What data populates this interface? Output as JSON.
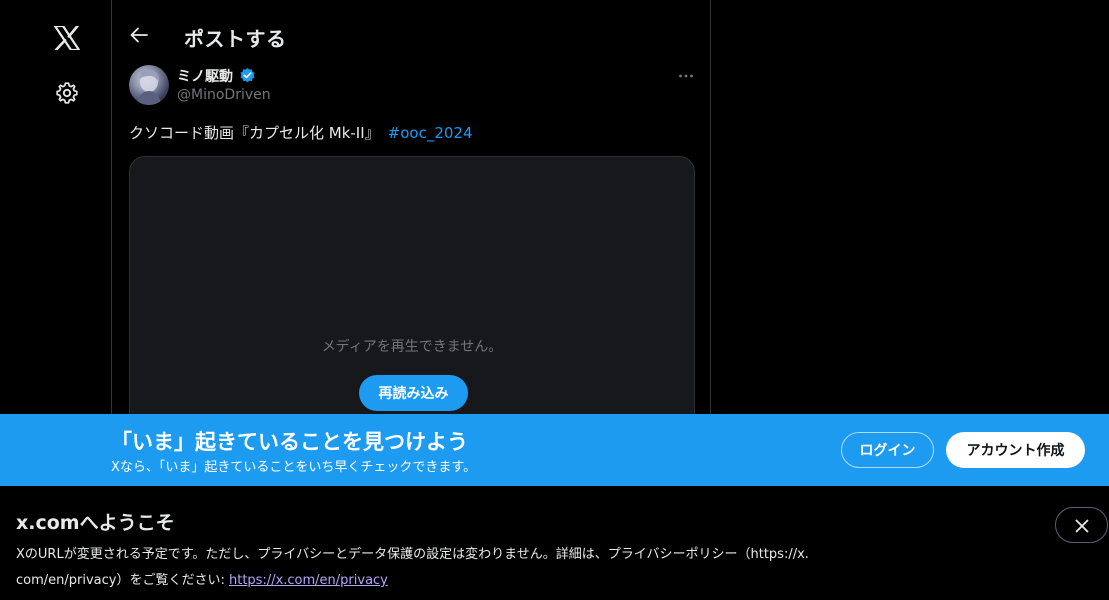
{
  "nav": {
    "logo_icon": "x-logo-icon",
    "settings_icon": "gear-icon"
  },
  "header": {
    "title": "ポストする",
    "back_icon": "arrow-left-icon"
  },
  "post": {
    "author_name": "ミノ駆動",
    "author_handle": "@MinoDriven",
    "verified_icon": "verified-badge-icon",
    "more_icon": "more-horizontal-icon",
    "text": "クソコード動画『カプセル化 Mk-II』",
    "hashtag": "#ooc_2024",
    "media_message": "メディアを再生できません。",
    "reload_label": "再読み込み"
  },
  "banner": {
    "title": "「いま」起きていることを見つけよう",
    "subtitle": "Xなら、「いま」起きていることをいち早くチェックできます。",
    "login_label": "ログイン",
    "signup_label": "アカウント作成"
  },
  "notice": {
    "title": "x.comへようこそ",
    "body_line1": "XのURLが変更される予定です。ただし、プライバシーとデータ保護の設定は変わりません。詳細は、プライバシーポリシー（https://x.",
    "body_line2": "com/en/privacy）をご覧ください: ",
    "link_text": "https://x.com/en/privacy",
    "close_icon": "close-icon"
  },
  "colors": {
    "accent": "#1d9bf0",
    "background": "#000000",
    "media_bg": "#16181c",
    "secondary_text": "#71767b",
    "link_visited": "#b5a4f7"
  }
}
